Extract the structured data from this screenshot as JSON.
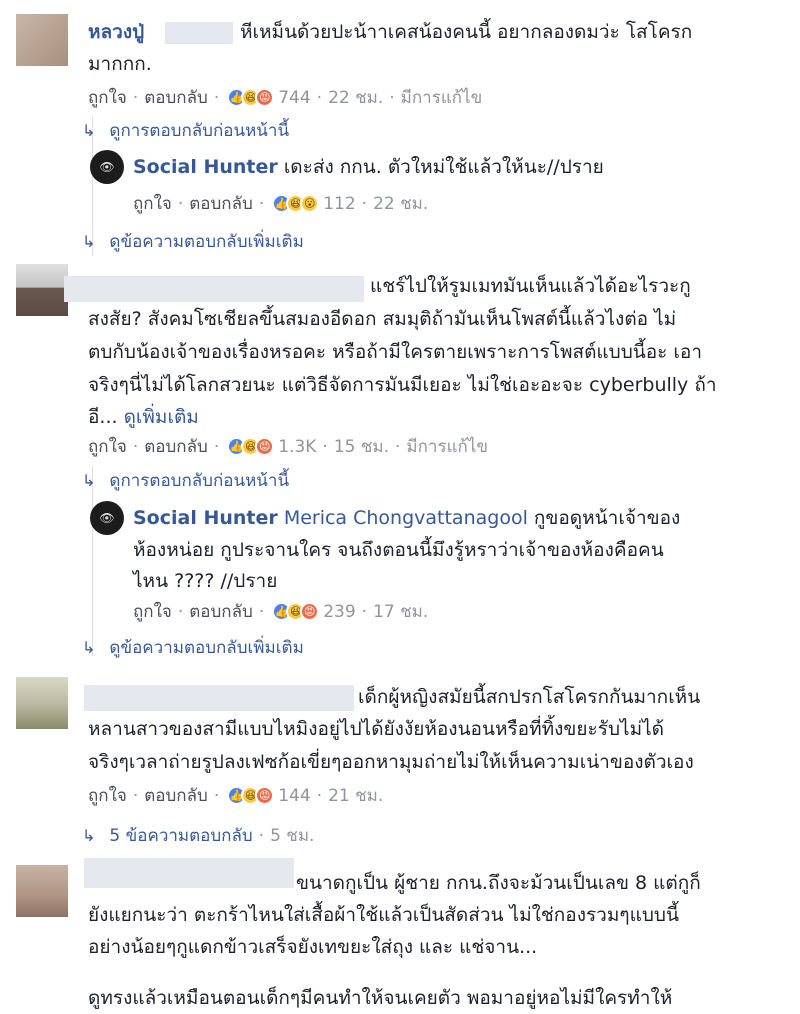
{
  "comments": [
    {
      "author": "หลวงปู่",
      "lines": [
        "หีเหม็นด้วยปะน้าาเคสน้องคนนี้ อยากลองดมว่ะ โสโครก",
        "มากกก."
      ],
      "like": "ถูกใจ",
      "reply": "ตอบกลับ",
      "count": "744",
      "time": "22 ชม.",
      "edited": "มีการแก้ไข",
      "prev_replies": "ดูการตอบกลับก่อนหน้านี้",
      "reply_item": {
        "author": "Social Hunter",
        "lines": [
          "เดะส่ง กกน. ตัวใหม่ใช้แล้วให้นะ//ปราย"
        ],
        "like": "ถูกใจ",
        "reply": "ตอบกลับ",
        "count": "112",
        "time": "22 ชม."
      },
      "more_replies": "ดูข้อความตอบกลับเพิ่มเติม"
    },
    {
      "lines": [
        "แชร์ไปให้รูมเมทมันเห็นแล้วได้อะไรวะกู",
        "สงสัย? สังคมโซเชียลขึ้นสมองอีดอก สมมุติถ้ามันเห็นโพสต์นี้แล้วไงต่อ ไม่",
        "ตบกับน้องเจ้าของเรื่องหรอคะ หรือถ้ามีใครตายเพราะการโพสต์แบบนี้อะ เอา",
        "จริงๆนี่ไม่ได้โลกสวยนะ แต่วิธีจัดการมันมีเยอะ ไม่ใช่เอะอะจะ cyberbully ถ้า",
        "อี..."
      ],
      "see_more": "ดูเพิ่มเติม",
      "like": "ถูกใจ",
      "reply": "ตอบกลับ",
      "count": "1.3K",
      "time": "15 ชม.",
      "edited": "มีการแก้ไข",
      "prev_replies": "ดูการตอบกลับก่อนหน้านี้",
      "reply_item": {
        "author": "Social Hunter",
        "tag": "Merica Chongvattanagool",
        "lines": [
          "กูขอดูหน้าเจ้าของ",
          "ห้องหน่อย กูประจานใคร จนถึงตอนนี้มึงรู้หราว่าเจ้าของห้องคือคน",
          "ไหน ???? //ปราย"
        ],
        "like": "ถูกใจ",
        "reply": "ตอบกลับ",
        "count": "239",
        "time": "17 ชม."
      },
      "more_replies": "ดูข้อความตอบกลับเพิ่มเติม"
    },
    {
      "lines": [
        "เด็กผู้หญิงสมัยนี้สกปรกโสโครกกันมากเห็น",
        "หลานสาวของสามีแบบไหมิงอยู่ไปได้ยังงัยห้องนอนหรือที่ทิ้งขยะรับไม่ได้",
        "จริงๆเวลาถ่ายรูปลงเฟซก้อเขี่ยๆออกหามุมถ่ายไม่ให้เห็นความเน่าของตัวเอง"
      ],
      "like": "ถูกใจ",
      "reply": "ตอบกลับ",
      "count": "144",
      "time": "21 ชม.",
      "replies_summary": "5 ข้อความตอบกลับ",
      "replies_time": "5 ชม."
    },
    {
      "lines": [
        "ขนาดกูเป็น ผู้ชาย กกน.ถึงจะม้วนเป็นเลข 8 แต่กูก็",
        "ยังแยกนะว่า ตะกร้าไหนใส่เสื้อผ้าใช้แล้วเป็นสัดส่วน ไม่ใช่กองรวมๆแบบนี้",
        "อย่างน้อยๆกูแดกข้าวเสร็จยังเทขยะใส่ถุง และ แช่จาน...",
        "ดูทรงแล้วเหมือนตอนเด็กๆมีคนทำให้จนเคยตัว พอมาอยู่หอไม่มีใครทำให้"
      ]
    }
  ],
  "colors": {
    "link": "#365899",
    "meta": "#90949c",
    "like": "#4a80f5",
    "haha": "#f7c948",
    "angry": "#f0684a"
  }
}
